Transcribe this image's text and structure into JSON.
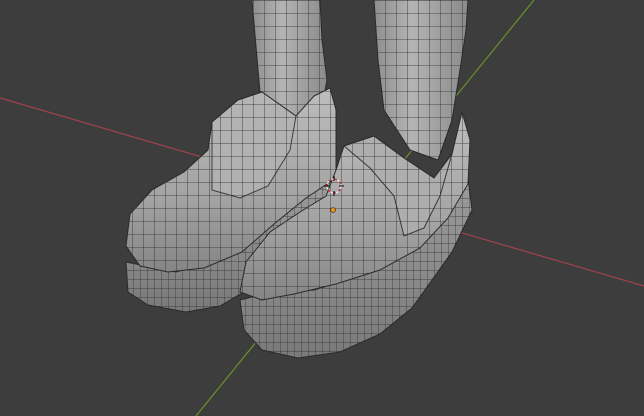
{
  "viewport": {
    "mode": "3d-viewport",
    "shading": "solid",
    "overlay": "wireframe",
    "background_color": "#3d3d3d",
    "mesh_color": "#a7a7a7",
    "wire_color": "#2a2a2a",
    "x_axis_color": "#a0424e",
    "y_axis_color": "#6c8f2c",
    "origin_color": "#e8901c"
  },
  "scene": {
    "objects": [
      "left-shoe",
      "right-shoe",
      "left-leg",
      "right-leg"
    ],
    "cursor": "3d-cursor",
    "origin": "object-origin"
  }
}
